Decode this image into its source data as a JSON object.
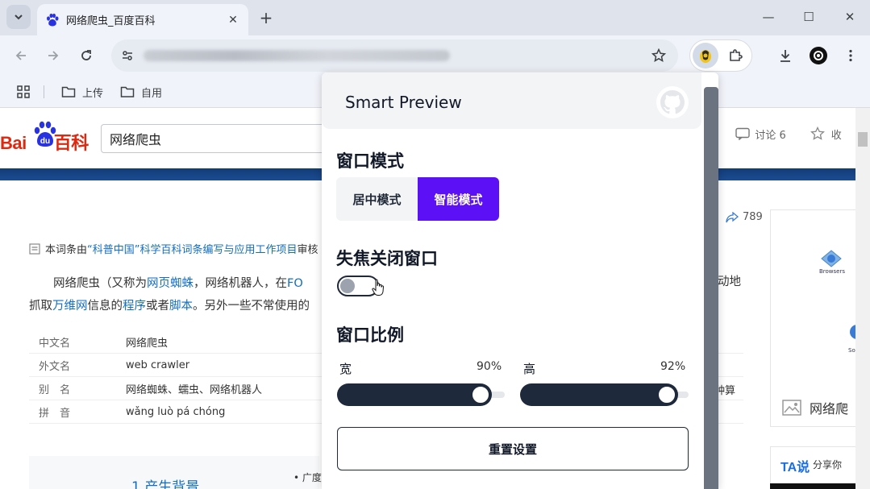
{
  "browser": {
    "tab_title": "网络爬虫_百度百科",
    "tab_close": "✕",
    "new_tab": "+",
    "window_controls": {
      "minimize": "—",
      "maximize": "☐",
      "close": "✕"
    },
    "url": "",
    "bookmarks": [
      {
        "label": "上传",
        "icon": "folder-icon"
      },
      {
        "label": "自用",
        "icon": "folder-icon"
      }
    ]
  },
  "baidu": {
    "logo_text_left": "Bai",
    "logo_text_du": "du",
    "logo_text_right": "百科",
    "search_value": "网络爬虫",
    "discuss_label": "讨论 6",
    "collect_label": "收",
    "share_count": "789",
    "info_prefix": "本词条由",
    "info_link": "“科普中国”科学百科词条编写与应用工作项目",
    "info_suffix": " 审核",
    "para_start": "网络爬虫（又称为",
    "para_link1": "网页蜘蛛",
    "para_mid1": "，网络机器人，在",
    "para_link2": "FO",
    "para_right1": "动地",
    "para2_start": "抓取",
    "para2_link1": "万维网",
    "para2_mid1": "信息的",
    "para2_link2": "程序",
    "para2_mid2": "或者",
    "para2_link3": "脚本",
    "para2_end": "。另外一些不常使用的",
    "table": [
      {
        "key": "中文名",
        "value": "网络爬虫",
        "right": ""
      },
      {
        "key": "外文名",
        "value": "web crawler",
        "right": ""
      },
      {
        "key": "别　名",
        "value": "网络蜘蛛、蠕虫、网络机器人",
        "right": "种算"
      },
      {
        "key": "拼　音",
        "value": "wǎng luò pá chóng",
        "right": ""
      }
    ],
    "catalog_title": "1  产生背景",
    "breadth_label": "• 广度",
    "side_caption": "网络爬",
    "side_browsers": "Browsers",
    "side_so": "So",
    "ta_logo": "TA说",
    "ta_text": "分享你"
  },
  "popup": {
    "title": "Smart Preview",
    "window_mode_title": "窗口模式",
    "mode_center": "居中模式",
    "mode_smart": "智能模式",
    "selected_mode": "智能模式",
    "blur_close_title": "失焦关闭窗口",
    "blur_close_enabled": false,
    "ratio_title": "窗口比例",
    "width_label": "宽",
    "width_value": "90%",
    "width_ratio": 0.9,
    "height_label": "高",
    "height_value": "92%",
    "height_ratio": 0.92,
    "reset_label": "重置设置",
    "accent_color": "#5b10f5"
  }
}
